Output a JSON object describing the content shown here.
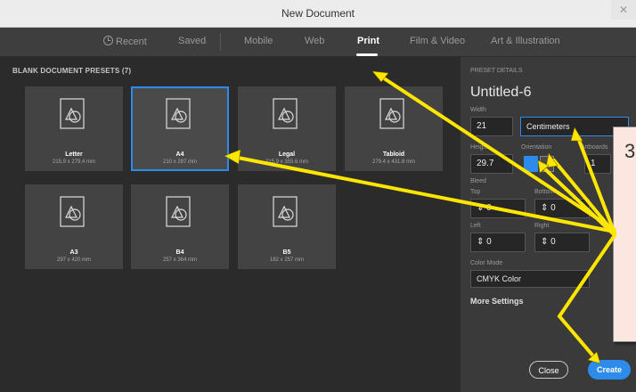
{
  "window": {
    "title": "New Document",
    "close_glyph": "✕"
  },
  "tabs": [
    {
      "label": "Recent",
      "icon": "clock-icon"
    },
    {
      "label": "Saved"
    },
    {
      "label": "Mobile"
    },
    {
      "label": "Web"
    },
    {
      "label": "Print",
      "active": true
    },
    {
      "label": "Film & Video"
    },
    {
      "label": "Art & Illustration"
    }
  ],
  "presets_section": {
    "title": "BLANK DOCUMENT PRESETS (7)",
    "items": [
      {
        "name": "Letter",
        "size": "215.9 x 279.4 mm",
        "icon": "document-icon"
      },
      {
        "name": "A4",
        "size": "210 x 297 mm",
        "selected": true,
        "icon": "document-icon"
      },
      {
        "name": "Legal",
        "size": "215.9 x 355.6 mm",
        "icon": "document-icon"
      },
      {
        "name": "Tabloid",
        "size": "279.4 x 431.8 mm",
        "icon": "document-icon"
      },
      {
        "name": "A3",
        "size": "297 x 420 mm",
        "icon": "document-icon"
      },
      {
        "name": "B4",
        "size": "257 x 364 mm",
        "icon": "document-icon"
      },
      {
        "name": "B5",
        "size": "182 x 257 mm",
        "icon": "document-icon"
      }
    ]
  },
  "details": {
    "heading": "PRESET DETAILS",
    "doc_name": "Untitled-6",
    "width_label": "Width",
    "width_value": "21",
    "units_value": "Centimeters",
    "height_label": "Height",
    "height_value": "29.7",
    "orientation_label": "Orientation",
    "artboards_label": "Artboards",
    "artboards_value": "1",
    "bleed_label": "Bleed",
    "top_label": "Top",
    "top_value": "0",
    "bottom_label": "Bottom",
    "bottom_value": "0",
    "left_label": "Left",
    "left_value": "0",
    "right_label": "Right",
    "right_value": "0",
    "color_mode_label": "Color Mode",
    "color_mode_value": "CMYK Color",
    "more_settings": "More Settings"
  },
  "buttons": {
    "close": "Close",
    "create": "Create"
  },
  "callout": {
    "text": "3"
  },
  "colors": {
    "accent": "#2d8ceb",
    "arrow": "#ffe600"
  }
}
